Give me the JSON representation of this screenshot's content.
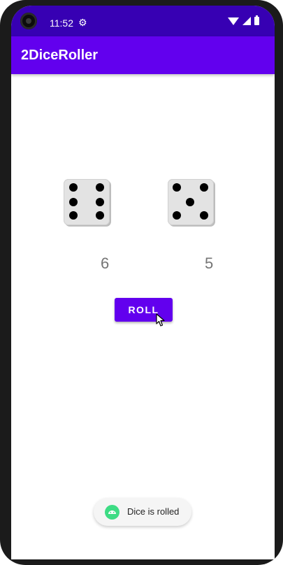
{
  "status_bar": {
    "time": "11:52",
    "settings_icon": "gear-icon",
    "icons": [
      "wifi-icon",
      "signal-icon",
      "battery-icon"
    ]
  },
  "app_bar": {
    "title": "2DiceRoller",
    "color": "#6200ee",
    "status_color": "#3700b3"
  },
  "dice": [
    {
      "value": 6,
      "label": "6"
    },
    {
      "value": 5,
      "label": "5"
    }
  ],
  "roll_button": {
    "label": "ROLL"
  },
  "toast": {
    "icon": "android-icon",
    "text": "Dice is rolled"
  }
}
